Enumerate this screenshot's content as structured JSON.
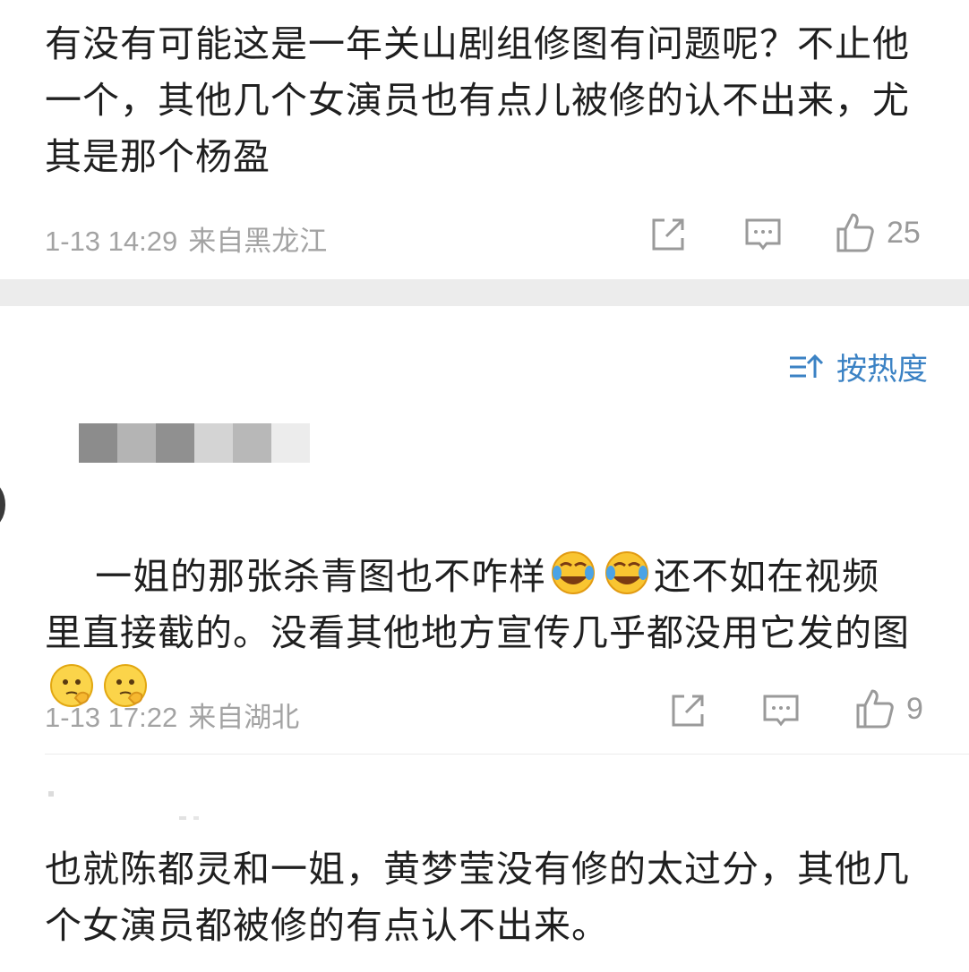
{
  "comments": [
    {
      "text": "有没有可能这是一年关山剧组修图有问题呢？不止他一个，其他几个女演员也有点儿被修的认不出来，尤其是那个杨盈",
      "time": "1-13 14:29",
      "location": "来自黑龙江",
      "likes": "25"
    },
    {
      "text_a": "一姐的那张杀青图也不咋样",
      "text_b": "还不如在视频里直接截的。没看其他地方宣传几乎都没用它发的图",
      "emoji_a": "laugh-cry-emoji",
      "emoji_b": "thinking-emoji",
      "time": "1-13 17:22",
      "location": "来自湖北",
      "likes": "9"
    },
    {
      "text": "也就陈都灵和一姐，黄梦莹没有修的太过分，其他几个女演员都被修的有点认不出来。"
    }
  ],
  "sort": {
    "label": "按热度"
  },
  "icons": {
    "share": "share-icon",
    "comment": "comment-icon",
    "like": "thumbs-up-icon",
    "sort": "sort-icon"
  },
  "colors": {
    "text": "#1f1f1f",
    "meta": "#a3a3a3",
    "accent": "#3b82c4",
    "band": "#ececec"
  }
}
